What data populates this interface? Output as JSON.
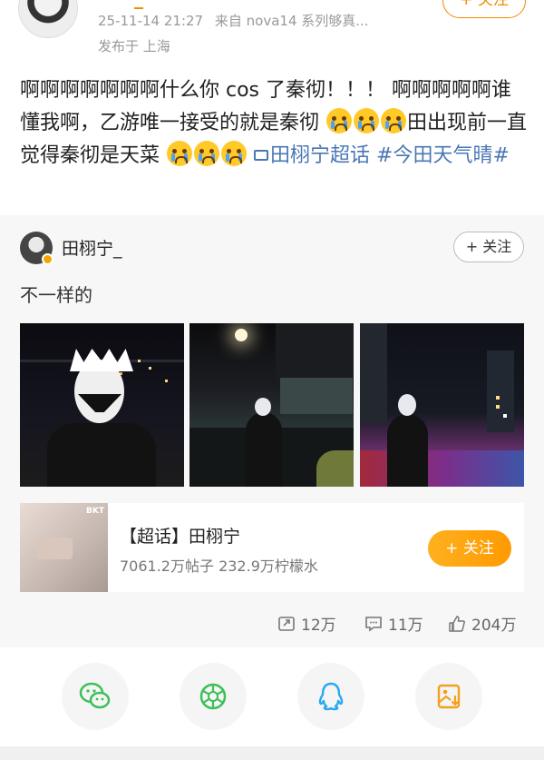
{
  "post": {
    "timestamp": "25-11-14 21:27",
    "source": "来自 nova14 系列够真...",
    "location": "发布于 上海",
    "follow_label": "+ 关注",
    "text_part1": "啊啊啊啊啊啊啊什么你 cos 了秦彻！！！ 啊啊啊啊啊谁懂我啊，乙游唯一接受的就是秦彻",
    "text_part2": "田出现前一直觉得秦彻是天菜",
    "topic_link": "田栩宁超话",
    "hashtag": "#今田天气晴#"
  },
  "repost": {
    "author": "田栩宁_",
    "follow_label": "+ 关注",
    "text": "不一样的",
    "topic_card": {
      "title": "【超话】田栩宁",
      "stats": "7061.2万帖子 232.9万柠檬水",
      "follow_label": "+ 关注",
      "thumb_brand": "BKT"
    },
    "stats": {
      "reposts": "12万",
      "comments": "11万",
      "likes": "204万"
    }
  },
  "icons": {
    "share": [
      "wechat-icon",
      "moments-icon",
      "qq-icon",
      "save-image-icon"
    ]
  },
  "colors": {
    "accent_orange": "#f18a00",
    "link_blue": "#4a77b5",
    "wechat_green": "#3dbf5a",
    "qq_blue": "#2aa8f2",
    "save_orange": "#f3a01c"
  }
}
